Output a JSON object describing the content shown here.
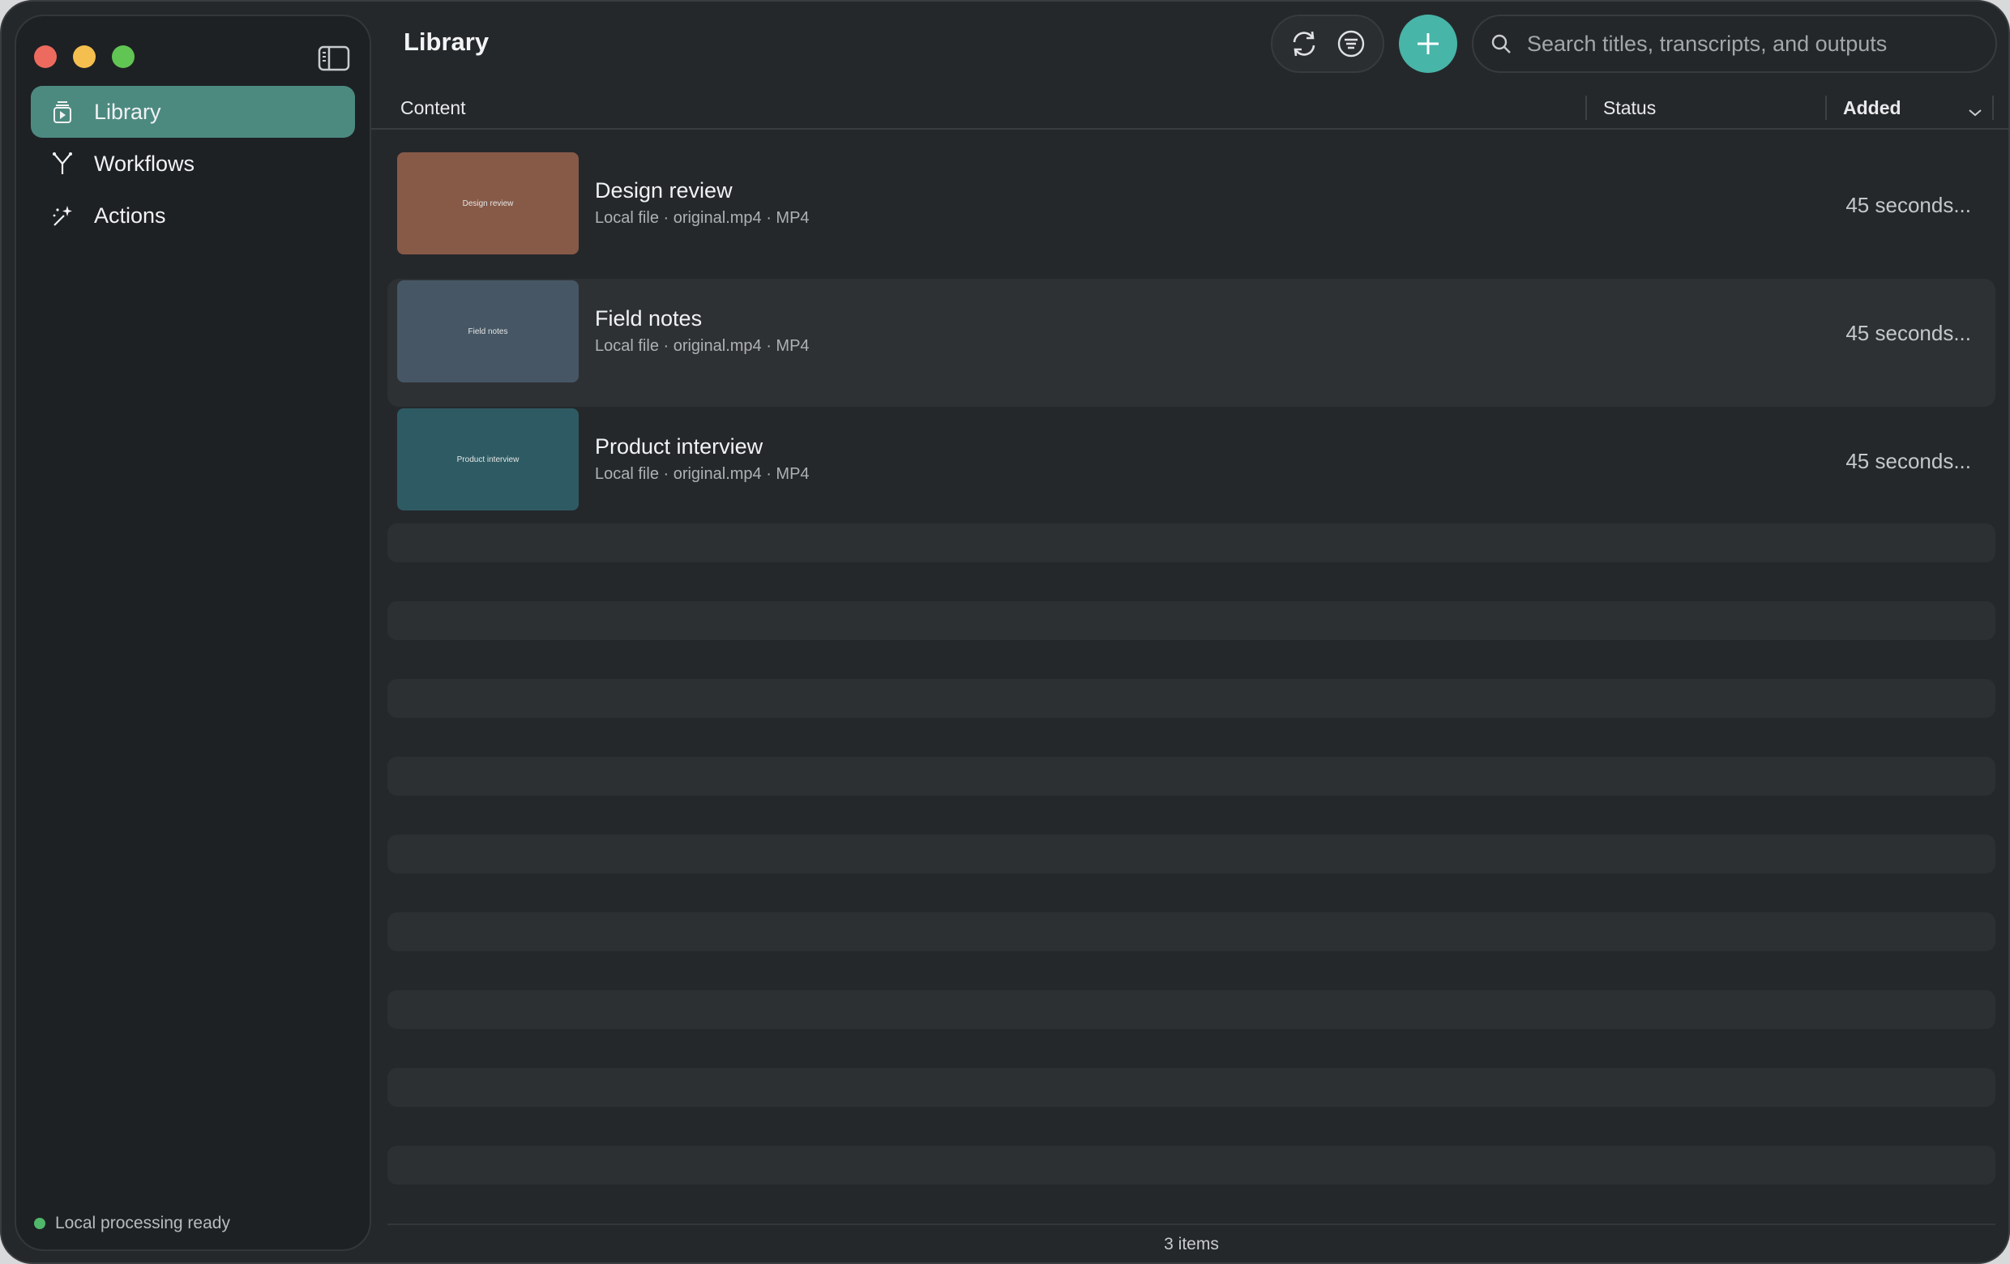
{
  "window": {
    "traffic_lights": [
      "close",
      "minimize",
      "zoom"
    ]
  },
  "sidebar": {
    "toggle_icon": "sidebar-toggle-icon",
    "items": [
      {
        "label": "Library",
        "icon": "library-icon",
        "active": true
      },
      {
        "label": "Workflows",
        "icon": "workflow-icon",
        "active": false
      },
      {
        "label": "Actions",
        "icon": "sparkle-icon",
        "active": false
      }
    ],
    "status": "Local processing ready"
  },
  "header": {
    "title": "Library",
    "search_placeholder": "Search titles, transcripts, and outputs"
  },
  "table": {
    "columns": {
      "content": "Content",
      "status": "Status",
      "added": "Added"
    },
    "rows": [
      {
        "title": "Design review",
        "subtitle": "Local file · original.mp4 · MP4",
        "thumb_label": "Design review",
        "thumb_color": "#875a48",
        "status": "",
        "added": "45 seconds..."
      },
      {
        "title": "Field notes",
        "subtitle": "Local file · original.mp4 · MP4",
        "thumb_label": "Field notes",
        "thumb_color": "#465664",
        "status": "",
        "added": "45 seconds..."
      },
      {
        "title": "Product interview",
        "subtitle": "Local file · original.mp4 · MP4",
        "thumb_label": "Product interview",
        "thumb_color": "#2e5b63",
        "status": "",
        "added": "45 seconds..."
      }
    ]
  },
  "footer": {
    "count": "3 items"
  },
  "colors": {
    "accent": "#47b5a8",
    "active_nav": "#4c8a80",
    "ready_dot": "#4fb86a"
  }
}
